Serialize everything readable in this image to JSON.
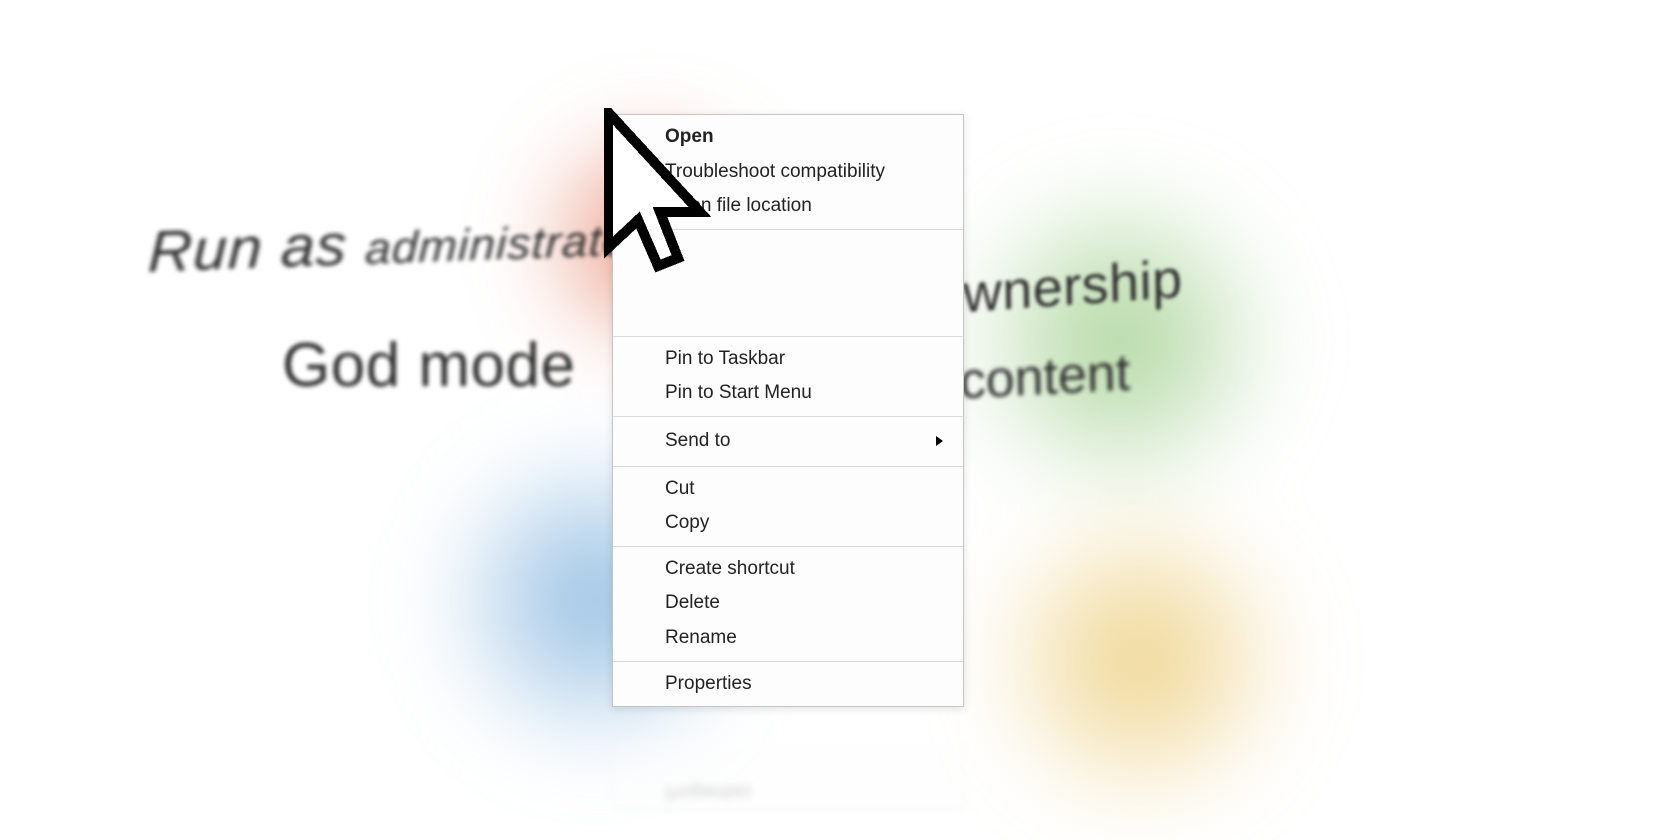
{
  "background_text": {
    "run_as_admin": "Run as administrator",
    "god_mode": "God mode",
    "take_ownership": "Take ownership",
    "copy_content": "Copy content"
  },
  "context_menu": {
    "groups": [
      {
        "items": [
          {
            "label": "Open",
            "bold": true
          },
          {
            "label": "Troubleshoot compatibility"
          },
          {
            "label": "Open file location"
          }
        ]
      },
      {
        "blank_rows": 3,
        "items": []
      },
      {
        "items": [
          {
            "label": "Pin to Taskbar"
          },
          {
            "label": "Pin to Start Menu"
          }
        ]
      },
      {
        "items": [
          {
            "label": "Send to",
            "submenu": true
          }
        ]
      },
      {
        "items": [
          {
            "label": "Cut"
          },
          {
            "label": "Copy"
          }
        ]
      },
      {
        "items": [
          {
            "label": "Create shortcut"
          },
          {
            "label": "Delete"
          },
          {
            "label": "Rename"
          }
        ]
      },
      {
        "items": [
          {
            "label": "Properties"
          }
        ]
      }
    ]
  },
  "reflection_label": "Properties"
}
